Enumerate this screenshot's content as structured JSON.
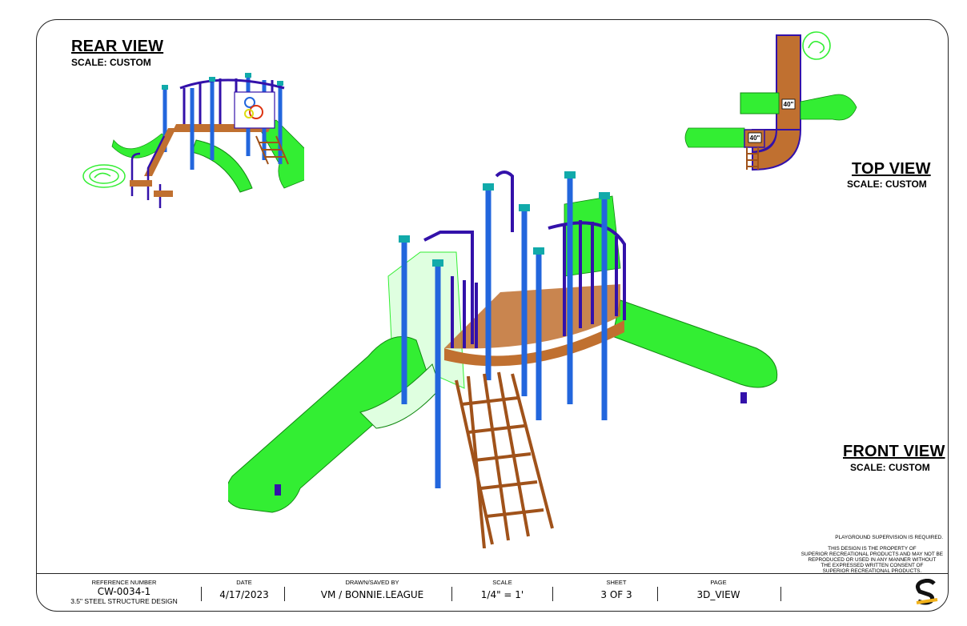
{
  "views": {
    "rear": {
      "title": "REAR VIEW",
      "scale": "SCALE: CUSTOM"
    },
    "top": {
      "title": "TOP VIEW",
      "scale": "SCALE: CUSTOM"
    },
    "front": {
      "title": "FRONT VIEW",
      "scale": "SCALE: CUSTOM"
    }
  },
  "top_view_labels": {
    "deck_a": "40\"",
    "deck_b": "40\""
  },
  "notes": {
    "supervision": "PLAYGROUND SUPERVISION IS REQUIRED.",
    "property_lines": [
      "THIS DESIGN IS THE PROPERTY OF",
      "SUPERIOR RECREATIONAL PRODUCTS AND MAY NOT BE",
      "REPRODUCED OR USED IN ANY MANNER WITHOUT",
      "THE EXPRESSED WRITTEN CONSENT OF",
      "SUPERIOR RECREATIONAL PRODUCTS."
    ]
  },
  "title_block": {
    "reference": {
      "header": "REFERENCE NUMBER",
      "value": "CW-0034-1",
      "sub": "3.5\" STEEL STRUCTURE DESIGN"
    },
    "date": {
      "header": "DATE",
      "value": "4/17/2023"
    },
    "drawn": {
      "header": "DRAWN/SAVED BY",
      "value": "VM / BONNIE.LEAGUE"
    },
    "scale": {
      "header": "SCALE",
      "value": "1/4\" = 1'"
    },
    "sheet": {
      "header": "SHEET",
      "value": "3 OF 3"
    },
    "page": {
      "header": "PAGE",
      "value": "3D_VIEW"
    }
  },
  "colors": {
    "slide": "#33ee33",
    "post": "#2266dd",
    "rail": "#3311aa",
    "cap": "#11aaaa",
    "deck": "#c07030",
    "ladder": "#a0521a"
  }
}
